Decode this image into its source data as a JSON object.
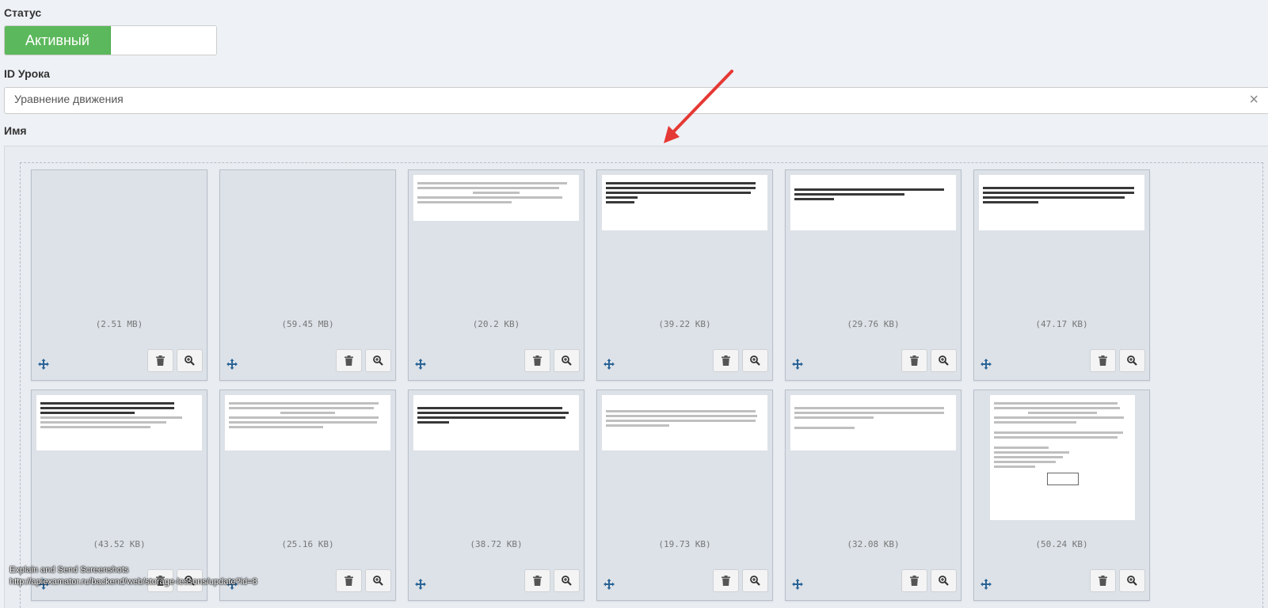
{
  "status": {
    "label": "Статус",
    "active_label": "Активный"
  },
  "lesson": {
    "label": "ID Урока",
    "value": "Уравнение движения",
    "clear": "×"
  },
  "name": {
    "label": "Имя"
  },
  "files": [
    {
      "size": "(2.51 MB)"
    },
    {
      "size": "(59.45 MB)"
    },
    {
      "size": "(20.2 KB)"
    },
    {
      "size": "(39.22 KB)"
    },
    {
      "size": "(29.76 KB)"
    },
    {
      "size": "(47.17 KB)"
    },
    {
      "size": "(43.52 KB)"
    },
    {
      "size": "(25.16 KB)"
    },
    {
      "size": "(38.72 KB)"
    },
    {
      "size": "(19.73 KB)"
    },
    {
      "size": "(32.08 KB)"
    },
    {
      "size": "(50.24 KB)"
    }
  ],
  "tooltip": {
    "line1": "Explain and Send Screenshots",
    "line2": "http://apiexamator.ru/backend/web/storage-lessons/update?id=8"
  },
  "colors": {
    "active": "#5cb85c",
    "arrow": "#e53935",
    "move_icon": "#2a6496"
  }
}
